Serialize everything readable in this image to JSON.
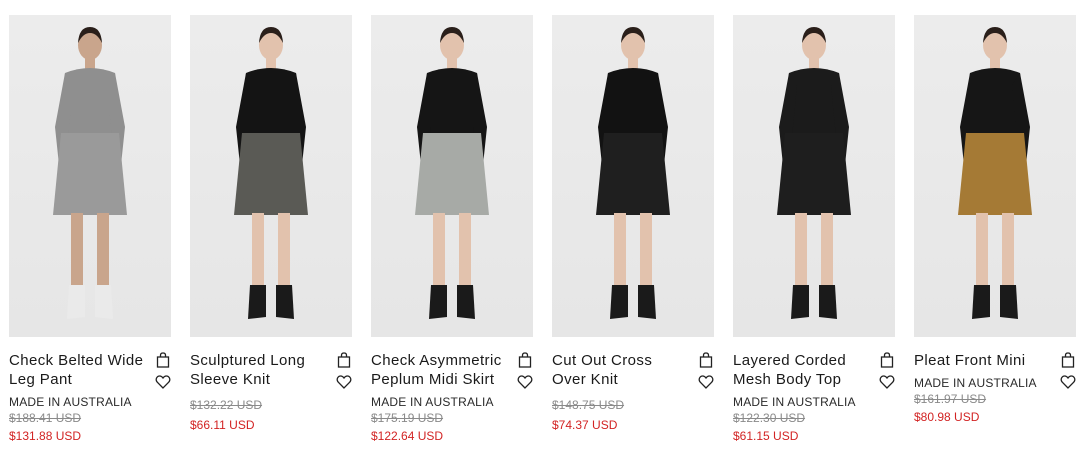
{
  "products": [
    {
      "name": "Check Belted Wide Leg Pant",
      "origin": "MADE IN AUSTRALIA",
      "original_price": "$188.41 USD",
      "sale_price": "$131.88 USD",
      "outfit": {
        "top": "#8f8f8f",
        "bottom": "#9a9a9a",
        "shoes": "#eaeaea",
        "skin": "#c9a58c"
      }
    },
    {
      "name": "Sculptured Long Sleeve Knit",
      "origin": "",
      "original_price": "$132.22 USD",
      "sale_price": "$66.11 USD",
      "outfit": {
        "top": "#141414",
        "bottom": "#5a5a55",
        "shoes": "#1a1a1a",
        "skin": "#e2c2ad"
      }
    },
    {
      "name": "Check Asymmetric Peplum Midi Skirt",
      "origin": "MADE IN AUSTRALIA",
      "original_price": "$175.19 USD",
      "sale_price": "$122.64 USD",
      "outfit": {
        "top": "#151515",
        "bottom": "#a7aaa6",
        "shoes": "#1a1a1a",
        "skin": "#e2c2ad"
      }
    },
    {
      "name": "Cut Out Cross Over Knit",
      "origin": "",
      "original_price": "$148.75 USD",
      "sale_price": "$74.37 USD",
      "outfit": {
        "top": "#121212",
        "bottom": "#1f1f1f",
        "shoes": "#1a1a1a",
        "skin": "#e2c2ad"
      }
    },
    {
      "name": "Layered Corded Mesh Body Top",
      "origin": "MADE IN AUSTRALIA",
      "original_price": "$122.30 USD",
      "sale_price": "$61.15 USD",
      "outfit": {
        "top": "#1b1b1b",
        "bottom": "#1e1e1e",
        "shoes": "#1a1a1a",
        "skin": "#e2c2ad"
      }
    },
    {
      "name": "Pleat Front Mini",
      "origin": "MADE IN AUSTRALIA",
      "original_price": "$161.97 USD",
      "sale_price": "$80.98 USD",
      "outfit": {
        "top": "#161616",
        "bottom": "#a57a35",
        "shoes": "#1a1a1a",
        "skin": "#e2c2ad"
      }
    }
  ],
  "icons": {
    "bag": "shopping-bag-icon",
    "wishlist": "heart-icon"
  },
  "colors": {
    "sale_price": "#d22323",
    "original_price": "#8a8a8a",
    "text": "#1a1a1a"
  }
}
